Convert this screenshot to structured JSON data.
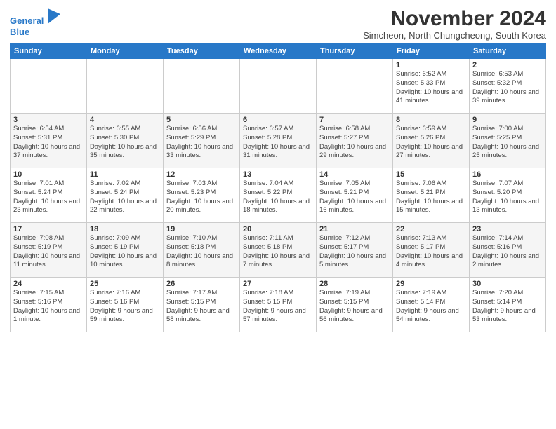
{
  "header": {
    "logo_line1": "General",
    "logo_line2": "Blue",
    "month_year": "November 2024",
    "subtitle": "Simcheon, North Chungcheong, South Korea"
  },
  "weekdays": [
    "Sunday",
    "Monday",
    "Tuesday",
    "Wednesday",
    "Thursday",
    "Friday",
    "Saturday"
  ],
  "weeks": [
    [
      {
        "day": "",
        "info": ""
      },
      {
        "day": "",
        "info": ""
      },
      {
        "day": "",
        "info": ""
      },
      {
        "day": "",
        "info": ""
      },
      {
        "day": "",
        "info": ""
      },
      {
        "day": "1",
        "info": "Sunrise: 6:52 AM\nSunset: 5:33 PM\nDaylight: 10 hours and 41 minutes."
      },
      {
        "day": "2",
        "info": "Sunrise: 6:53 AM\nSunset: 5:32 PM\nDaylight: 10 hours and 39 minutes."
      }
    ],
    [
      {
        "day": "3",
        "info": "Sunrise: 6:54 AM\nSunset: 5:31 PM\nDaylight: 10 hours and 37 minutes."
      },
      {
        "day": "4",
        "info": "Sunrise: 6:55 AM\nSunset: 5:30 PM\nDaylight: 10 hours and 35 minutes."
      },
      {
        "day": "5",
        "info": "Sunrise: 6:56 AM\nSunset: 5:29 PM\nDaylight: 10 hours and 33 minutes."
      },
      {
        "day": "6",
        "info": "Sunrise: 6:57 AM\nSunset: 5:28 PM\nDaylight: 10 hours and 31 minutes."
      },
      {
        "day": "7",
        "info": "Sunrise: 6:58 AM\nSunset: 5:27 PM\nDaylight: 10 hours and 29 minutes."
      },
      {
        "day": "8",
        "info": "Sunrise: 6:59 AM\nSunset: 5:26 PM\nDaylight: 10 hours and 27 minutes."
      },
      {
        "day": "9",
        "info": "Sunrise: 7:00 AM\nSunset: 5:25 PM\nDaylight: 10 hours and 25 minutes."
      }
    ],
    [
      {
        "day": "10",
        "info": "Sunrise: 7:01 AM\nSunset: 5:24 PM\nDaylight: 10 hours and 23 minutes."
      },
      {
        "day": "11",
        "info": "Sunrise: 7:02 AM\nSunset: 5:24 PM\nDaylight: 10 hours and 22 minutes."
      },
      {
        "day": "12",
        "info": "Sunrise: 7:03 AM\nSunset: 5:23 PM\nDaylight: 10 hours and 20 minutes."
      },
      {
        "day": "13",
        "info": "Sunrise: 7:04 AM\nSunset: 5:22 PM\nDaylight: 10 hours and 18 minutes."
      },
      {
        "day": "14",
        "info": "Sunrise: 7:05 AM\nSunset: 5:21 PM\nDaylight: 10 hours and 16 minutes."
      },
      {
        "day": "15",
        "info": "Sunrise: 7:06 AM\nSunset: 5:21 PM\nDaylight: 10 hours and 15 minutes."
      },
      {
        "day": "16",
        "info": "Sunrise: 7:07 AM\nSunset: 5:20 PM\nDaylight: 10 hours and 13 minutes."
      }
    ],
    [
      {
        "day": "17",
        "info": "Sunrise: 7:08 AM\nSunset: 5:19 PM\nDaylight: 10 hours and 11 minutes."
      },
      {
        "day": "18",
        "info": "Sunrise: 7:09 AM\nSunset: 5:19 PM\nDaylight: 10 hours and 10 minutes."
      },
      {
        "day": "19",
        "info": "Sunrise: 7:10 AM\nSunset: 5:18 PM\nDaylight: 10 hours and 8 minutes."
      },
      {
        "day": "20",
        "info": "Sunrise: 7:11 AM\nSunset: 5:18 PM\nDaylight: 10 hours and 7 minutes."
      },
      {
        "day": "21",
        "info": "Sunrise: 7:12 AM\nSunset: 5:17 PM\nDaylight: 10 hours and 5 minutes."
      },
      {
        "day": "22",
        "info": "Sunrise: 7:13 AM\nSunset: 5:17 PM\nDaylight: 10 hours and 4 minutes."
      },
      {
        "day": "23",
        "info": "Sunrise: 7:14 AM\nSunset: 5:16 PM\nDaylight: 10 hours and 2 minutes."
      }
    ],
    [
      {
        "day": "24",
        "info": "Sunrise: 7:15 AM\nSunset: 5:16 PM\nDaylight: 10 hours and 1 minute."
      },
      {
        "day": "25",
        "info": "Sunrise: 7:16 AM\nSunset: 5:16 PM\nDaylight: 9 hours and 59 minutes."
      },
      {
        "day": "26",
        "info": "Sunrise: 7:17 AM\nSunset: 5:15 PM\nDaylight: 9 hours and 58 minutes."
      },
      {
        "day": "27",
        "info": "Sunrise: 7:18 AM\nSunset: 5:15 PM\nDaylight: 9 hours and 57 minutes."
      },
      {
        "day": "28",
        "info": "Sunrise: 7:19 AM\nSunset: 5:15 PM\nDaylight: 9 hours and 56 minutes."
      },
      {
        "day": "29",
        "info": "Sunrise: 7:19 AM\nSunset: 5:14 PM\nDaylight: 9 hours and 54 minutes."
      },
      {
        "day": "30",
        "info": "Sunrise: 7:20 AM\nSunset: 5:14 PM\nDaylight: 9 hours and 53 minutes."
      }
    ]
  ]
}
